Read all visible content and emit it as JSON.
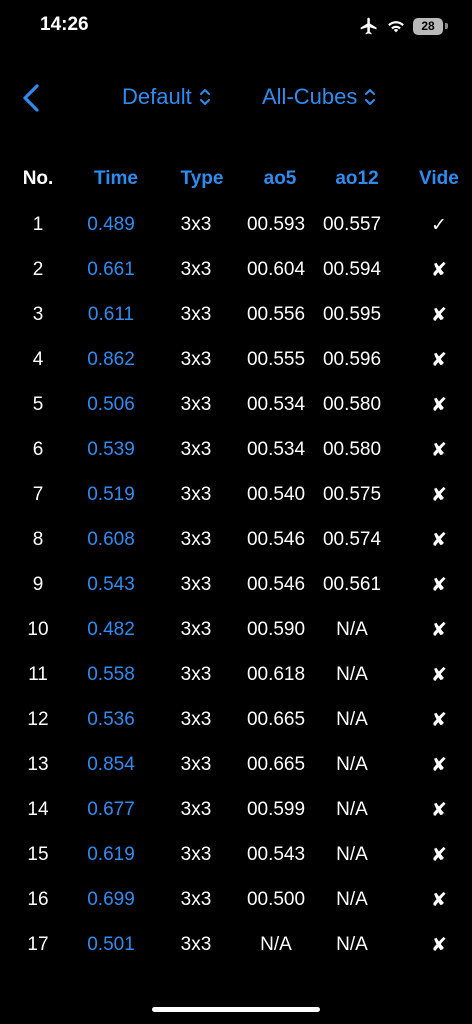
{
  "status_bar": {
    "time": "14:26",
    "battery": "28"
  },
  "nav": {
    "profile_picker": "Default",
    "puzzle_picker": "All-Cubes"
  },
  "table": {
    "headers": {
      "no": "No.",
      "time": "Time",
      "type": "Type",
      "ao5": "ao5",
      "ao12": "ao12",
      "video": "Vide"
    },
    "rows": [
      {
        "no": "1",
        "time": "0.489",
        "type": "3x3",
        "ao5": "00.593",
        "ao12": "00.557",
        "video": "✓"
      },
      {
        "no": "2",
        "time": "0.661",
        "type": "3x3",
        "ao5": "00.604",
        "ao12": "00.594",
        "video": "✘"
      },
      {
        "no": "3",
        "time": "0.611",
        "type": "3x3",
        "ao5": "00.556",
        "ao12": "00.595",
        "video": "✘"
      },
      {
        "no": "4",
        "time": "0.862",
        "type": "3x3",
        "ao5": "00.555",
        "ao12": "00.596",
        "video": "✘"
      },
      {
        "no": "5",
        "time": "0.506",
        "type": "3x3",
        "ao5": "00.534",
        "ao12": "00.580",
        "video": "✘"
      },
      {
        "no": "6",
        "time": "0.539",
        "type": "3x3",
        "ao5": "00.534",
        "ao12": "00.580",
        "video": "✘"
      },
      {
        "no": "7",
        "time": "0.519",
        "type": "3x3",
        "ao5": "00.540",
        "ao12": "00.575",
        "video": "✘"
      },
      {
        "no": "8",
        "time": "0.608",
        "type": "3x3",
        "ao5": "00.546",
        "ao12": "00.574",
        "video": "✘"
      },
      {
        "no": "9",
        "time": "0.543",
        "type": "3x3",
        "ao5": "00.546",
        "ao12": "00.561",
        "video": "✘"
      },
      {
        "no": "10",
        "time": "0.482",
        "type": "3x3",
        "ao5": "00.590",
        "ao12": "N/A",
        "video": "✘"
      },
      {
        "no": "11",
        "time": "0.558",
        "type": "3x3",
        "ao5": "00.618",
        "ao12": "N/A",
        "video": "✘"
      },
      {
        "no": "12",
        "time": "0.536",
        "type": "3x3",
        "ao5": "00.665",
        "ao12": "N/A",
        "video": "✘"
      },
      {
        "no": "13",
        "time": "0.854",
        "type": "3x3",
        "ao5": "00.665",
        "ao12": "N/A",
        "video": "✘"
      },
      {
        "no": "14",
        "time": "0.677",
        "type": "3x3",
        "ao5": "00.599",
        "ao12": "N/A",
        "video": "✘"
      },
      {
        "no": "15",
        "time": "0.619",
        "type": "3x3",
        "ao5": "00.543",
        "ao12": "N/A",
        "video": "✘"
      },
      {
        "no": "16",
        "time": "0.699",
        "type": "3x3",
        "ao5": "00.500",
        "ao12": "N/A",
        "video": "✘"
      },
      {
        "no": "17",
        "time": "0.501",
        "type": "3x3",
        "ao5": "N/A",
        "ao12": "N/A",
        "video": "✘"
      }
    ]
  },
  "colors": {
    "accent": "#2d8cf0",
    "background": "#000000",
    "text": "#ffffff"
  },
  "icons": {
    "back": "chevron-left-icon",
    "picker": "chevron-up-down-icon",
    "airplane": "airplane-icon",
    "wifi": "wifi-icon",
    "battery": "battery-icon"
  }
}
